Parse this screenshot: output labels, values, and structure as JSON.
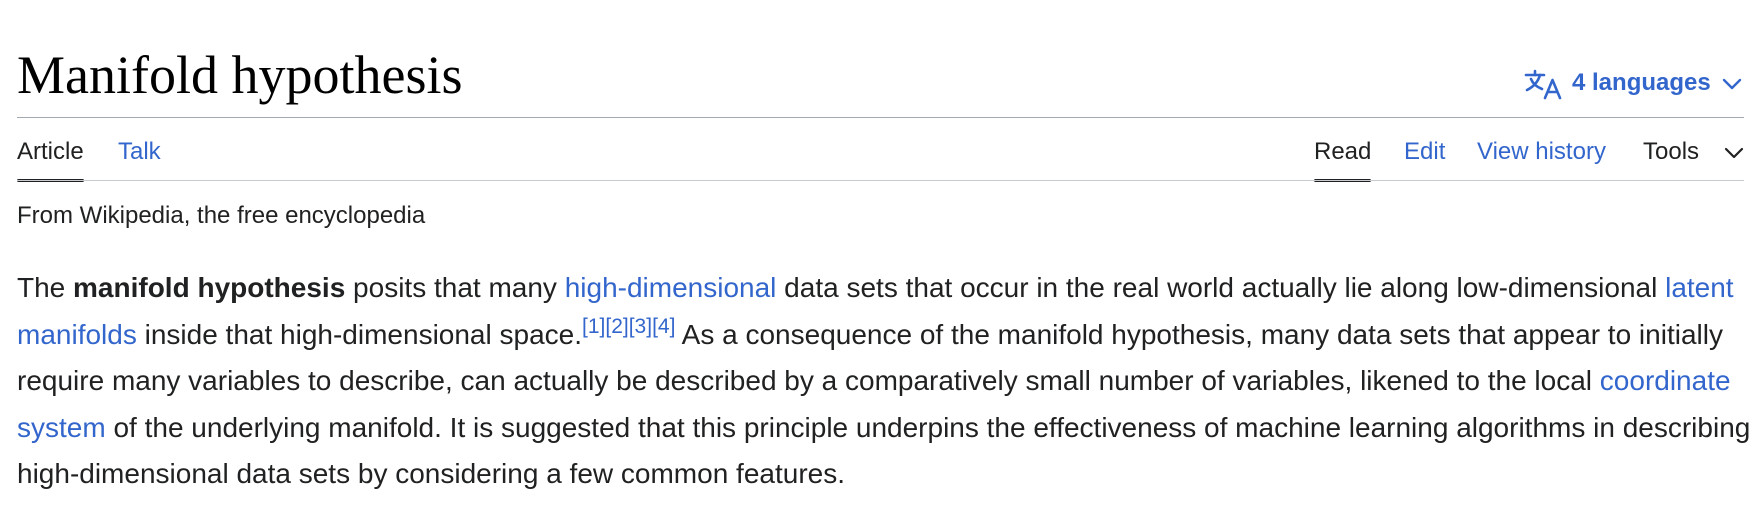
{
  "page": {
    "title": "Manifold hypothesis"
  },
  "languages": {
    "label": "4 languages",
    "icon": "translate-icon",
    "chevron_icon": "chevron-down-icon"
  },
  "tabs": {
    "left": [
      {
        "label": "Article",
        "selected": true
      },
      {
        "label": "Talk",
        "selected": false
      }
    ],
    "right": [
      {
        "label": "Read",
        "selected": true
      },
      {
        "label": "Edit",
        "selected": false
      },
      {
        "label": "View history",
        "selected": false
      },
      {
        "label": "Tools",
        "selected": false,
        "dropdown": true
      }
    ]
  },
  "tagline": "From Wikipedia, the free encyclopedia",
  "article": {
    "seg1": "The ",
    "bold_term": "manifold hypothesis",
    "seg2": " posits that many ",
    "link_high_dimensional": "high-dimensional",
    "seg3": " data sets that occur in the real world actually lie along low-dimensional ",
    "link_latent_manifolds": "latent manifolds",
    "seg4": " inside that high-dimensional space.",
    "citations": [
      "[1]",
      "[2]",
      "[3]",
      "[4]"
    ],
    "seg5": " As a consequence of the manifold hypothesis, many data sets that appear to initially require many variables to describe, can actually be described by a comparatively small number of variables, likened to the local ",
    "link_coordinate_system": "coordinate system",
    "seg6": " of the underlying manifold. It is suggested that this principle underpins the effectiveness of machine learning algorithms in describing high-dimensional data sets by considering a few common features."
  },
  "colors": {
    "link": "#3366cc",
    "text": "#202122",
    "title": "#000000",
    "rule": "#a2a9b1"
  }
}
